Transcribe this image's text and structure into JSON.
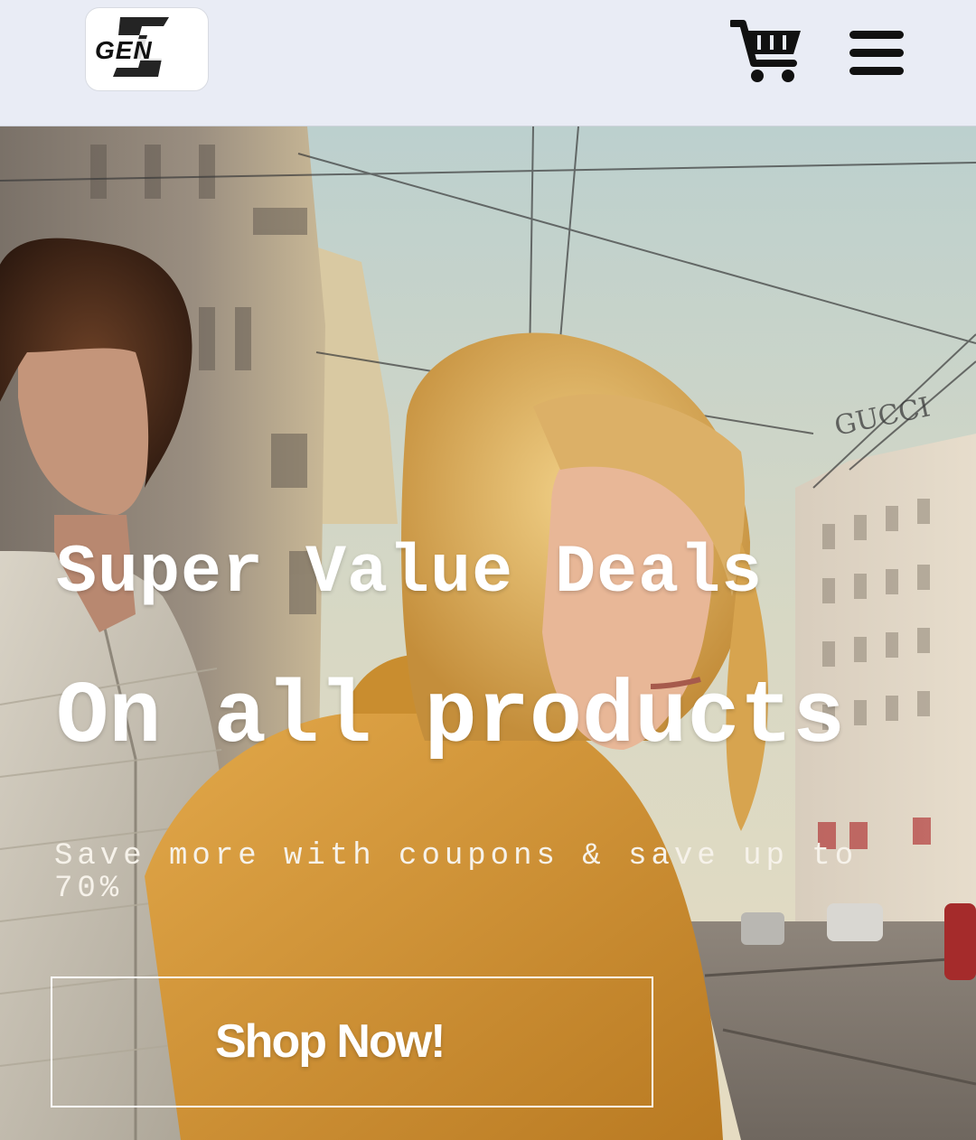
{
  "header": {
    "logo_text": "GEN",
    "logo_letter": "Z",
    "cart_icon": "shopping-cart-icon",
    "menu_icon": "hamburger-menu-icon"
  },
  "hero": {
    "headline_line1": "Super Value Deals",
    "headline_line2": "On all products",
    "subtext": "Save more with coupons & save up to 70%",
    "cta_label": "Shop Now!",
    "storefront_sign": "GUCCI"
  },
  "colors": {
    "header_bg": "#e9ecf5",
    "hero_text": "#ffffff",
    "icon_color": "#111111"
  }
}
